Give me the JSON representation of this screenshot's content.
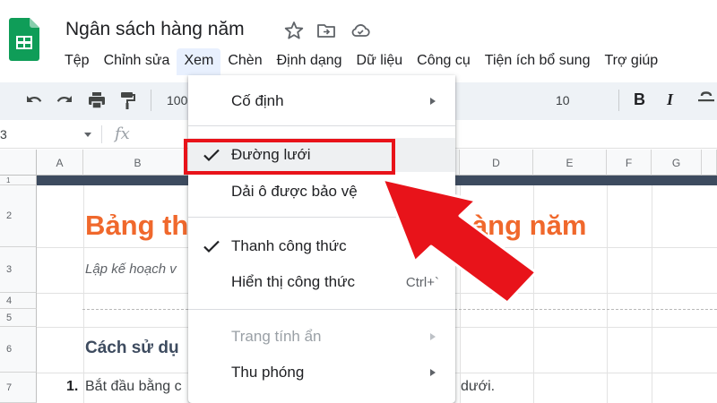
{
  "app": {
    "document_title": "Ngân sách hàng năm"
  },
  "menubar": [
    {
      "label": "Tệp"
    },
    {
      "label": "Chỉnh sửa"
    },
    {
      "label": "Xem",
      "active": true
    },
    {
      "label": "Chèn"
    },
    {
      "label": "Định dạng"
    },
    {
      "label": "Dữ liệu"
    },
    {
      "label": "Công cụ"
    },
    {
      "label": "Tiện ích bổ sung"
    },
    {
      "label": "Trợ giúp"
    }
  ],
  "toolbar": {
    "zoom_value": "100",
    "font_size": "10",
    "bold_label": "B",
    "italic_label": "I"
  },
  "formula_bar": {
    "name_box": "3",
    "fx_label": "fx"
  },
  "sheet": {
    "columns": [
      "A",
      "B",
      "C",
      "D",
      "E",
      "F",
      "G"
    ],
    "rows": [
      "1",
      "2",
      "3",
      "4",
      "5",
      "6",
      "7"
    ],
    "title": "Bảng th",
    "title_right": "hàng năm",
    "subtitle": "Lập kế hoạch v",
    "heading": "Cách sử dụ",
    "list_number": "1.",
    "list_text": "Bắt đầu bằng c",
    "list_text_right": "dưới."
  },
  "view_menu": {
    "items": [
      {
        "label": "Cố định",
        "submenu": true
      },
      {
        "label": "Đường lưới",
        "checked": true,
        "highlighted": true
      },
      {
        "label": "Dải ô được bảo vệ"
      },
      {
        "label": "Thanh công thức",
        "checked": true
      },
      {
        "label": "Hiển thị công thức",
        "shortcut": "Ctrl+`"
      },
      {
        "label": "Trang tính ẩn",
        "submenu": true,
        "disabled": true
      },
      {
        "label": "Thu phóng",
        "submenu": true
      }
    ]
  },
  "colors": {
    "accent_orange": "#f0682c",
    "sheets_green": "#0f9d58",
    "annotation_red": "#e8131a",
    "header_band": "#3d4b5f"
  }
}
